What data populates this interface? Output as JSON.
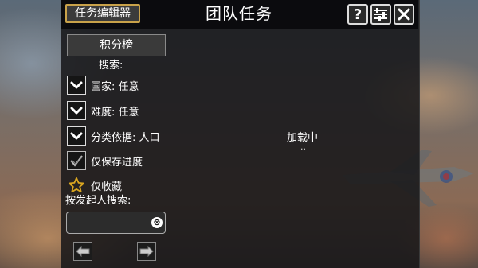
{
  "header": {
    "editor_button_label": "任务编辑器",
    "title": "团队任务",
    "help_icon": "?",
    "settings_icon": "settings-icon",
    "close_icon": "close-icon"
  },
  "sidebar": {
    "leaderboard_label": "积分榜",
    "search_label": "搜索:",
    "filters": [
      {
        "label": "国家: 任意"
      },
      {
        "label": "难度: 任意"
      },
      {
        "label": "分类依据: 人口"
      }
    ],
    "save_progress_label": "仅保存进度",
    "favorites_label": "仅收藏",
    "initiator_search_label": "按发起人搜索:",
    "initiator_search_value": "",
    "clear_icon": "⊗"
  },
  "main": {
    "loading_text": "加载中",
    "loading_dots": ".."
  },
  "colors": {
    "accent_gold": "#c9a24a",
    "panel_bg": "#161618",
    "text": "#ffffff"
  }
}
